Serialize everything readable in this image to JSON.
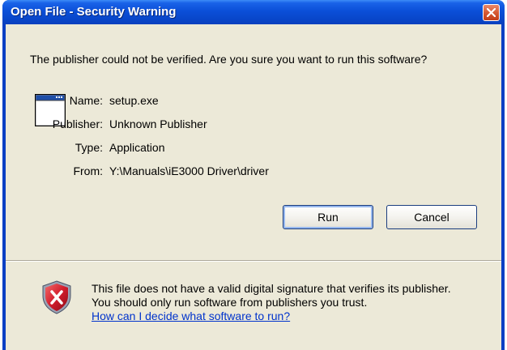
{
  "window": {
    "title": "Open File - Security Warning"
  },
  "message": "The publisher could not be verified.  Are you sure you want to run this software?",
  "details": [
    {
      "label": "Name:",
      "value": "setup.exe"
    },
    {
      "label": "Publisher:",
      "value": "Unknown Publisher"
    },
    {
      "label": "Type:",
      "value": "Application"
    },
    {
      "label": "From:",
      "value": "Y:\\Manuals\\iE3000 Driver\\driver"
    }
  ],
  "buttons": {
    "run": "Run",
    "cancel": "Cancel"
  },
  "warning": {
    "text": "This file does not have a valid digital signature that verifies its publisher.  You should only run software from publishers you trust.",
    "link": "How can I decide what software to run?"
  },
  "icons": {
    "close": "close-icon",
    "application": "application-window-icon",
    "shield": "security-shield-icon"
  },
  "colors": {
    "titlebar": "#0a4fd8",
    "dialog_bg": "#ece9d8",
    "link": "#0033cc",
    "close_button": "#d65a34",
    "shield": "#c8102e"
  }
}
